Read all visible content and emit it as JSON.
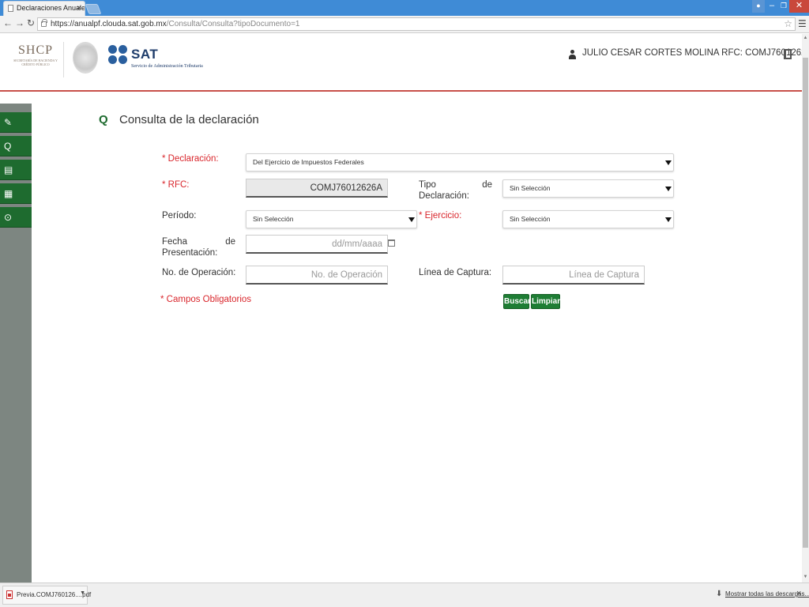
{
  "browser": {
    "tab_title": "Declaraciones Anuales",
    "tab_close": "×",
    "url_domain": "https://anualpf.clouda.sat.gob.mx",
    "url_path": "/Consulta/Consulta?tipoDocumento=1",
    "icons": {
      "back": "arrow-left",
      "forward": "arrow-right",
      "reload": "reload",
      "star": "star",
      "menu": "menu-lines"
    }
  },
  "header": {
    "shcp_title": "SHCP",
    "shcp_subtitle": "SECRETARÍA DE HACIENDA Y CRÉDITO PÚBLICO",
    "sat_title": "SAT",
    "sat_subtitle": "Servicio de Administración Tributaria",
    "user_label": "JULIO CESAR CORTES MOLINA RFC: COMJ76012626A",
    "colors": {
      "accent_line": "#c8504a",
      "sat_blue": "#2a5f9e"
    }
  },
  "sidebar": {
    "items": [
      {
        "icon": "edit-icon",
        "glyph": "✎"
      },
      {
        "icon": "search-icon",
        "glyph": "Q"
      },
      {
        "icon": "print-icon",
        "glyph": "▤"
      },
      {
        "icon": "archive-icon",
        "glyph": "▦"
      },
      {
        "icon": "info-icon",
        "glyph": "⊙"
      }
    ],
    "colors": {
      "button": "#1e6b2f",
      "rail": "#7d8681"
    }
  },
  "page": {
    "title_icon": "Q",
    "title": "Consulta de la declaración"
  },
  "form": {
    "declaracion": {
      "required_mark": "* ",
      "label": "Declaración:",
      "value": "Del Ejercicio de Impuestos Federales"
    },
    "rfc": {
      "required_mark": "* ",
      "label": "RFC:",
      "value": "COMJ76012626A"
    },
    "tipo": {
      "label_line1_a": "Tipo",
      "label_line1_b": "de",
      "label_line2": "Declaración:",
      "value": "Sin Selección"
    },
    "periodo": {
      "label": "Período:",
      "value": "Sin Selección"
    },
    "ejercicio": {
      "required_mark": "* ",
      "label": "Ejercicio:",
      "value": "Sin Selección"
    },
    "fecha": {
      "label_line1_a": "Fecha",
      "label_line1_b": "de",
      "label_line2": "Presentación:",
      "placeholder": "dd/mm/aaaa"
    },
    "operacion": {
      "label": "No. de Operación:",
      "placeholder": "No. de Operación"
    },
    "captura": {
      "label": "Línea de Captura:",
      "placeholder": "Línea de Captura"
    },
    "required_note": "* Campos Obligatorios",
    "buttons": {
      "search": "Buscar",
      "clear": "Limpiar"
    }
  },
  "downloads": {
    "file_name": "Previa.COMJ760126....pdf",
    "show_all": "Mostrar todas las descargas...",
    "close": "×"
  }
}
